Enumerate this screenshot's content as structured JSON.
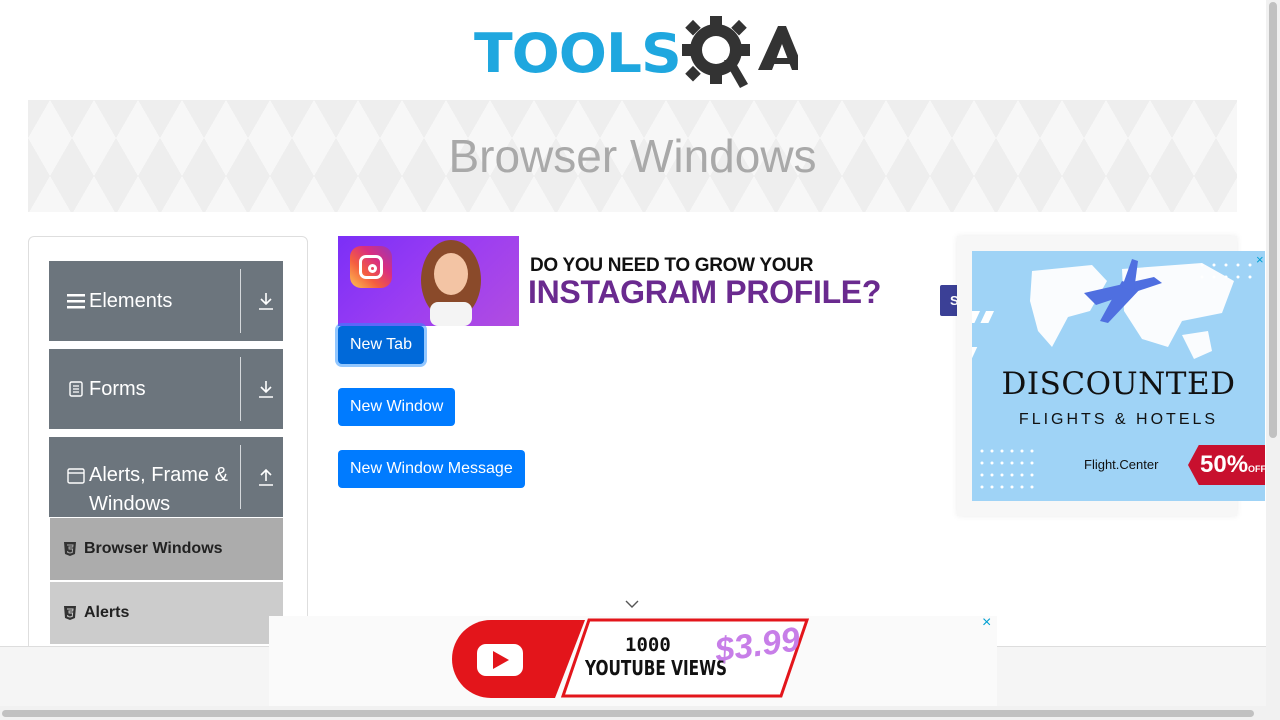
{
  "header": {
    "logo_text": "TOOLSQA"
  },
  "banner": {
    "title": "Browser Windows"
  },
  "sidebar": {
    "groups": [
      {
        "label": "Elements",
        "icon": "hamburger-icon",
        "arrow": "download-icon"
      },
      {
        "label": "Forms",
        "icon": "document-icon",
        "arrow": "download-icon"
      },
      {
        "label": "Alerts, Frame & Windows",
        "label_line1": "Alerts, Frame &",
        "label_line2": "Windows",
        "icon": "window-icon",
        "arrow": "upload-icon"
      }
    ],
    "subitems": [
      {
        "label": "Browser Windows",
        "active": true
      },
      {
        "label": "Alerts",
        "active": false
      }
    ]
  },
  "main": {
    "ad_instagram": {
      "line1": "DO YOU NEED TO GROW YOUR",
      "line2": "INSTAGRAM PROFILE?"
    },
    "partial_button": {
      "label": "S"
    },
    "buttons": [
      {
        "label": "New Tab"
      },
      {
        "label": "New Window"
      },
      {
        "label": "New Window Message"
      }
    ]
  },
  "ad_right": {
    "title": "DISCOUNTED",
    "subtitle": "FLIGHTS & HOTELS",
    "brand": "Flight.Center",
    "discount": "50%",
    "discount_suffix": "OFF",
    "close": "×"
  },
  "ad_bottom": {
    "line1": "1000",
    "line2": "YOUTUBE VIEWS",
    "price": "$3.99",
    "close": "×"
  },
  "colors": {
    "primary_button": "#007bff",
    "sidebar_group": "#6c757d",
    "sidebar_active": "#acacac",
    "sidebar_inactive": "#cccccc",
    "logo_blue": "#1fa7df",
    "logo_dark": "#333333"
  }
}
